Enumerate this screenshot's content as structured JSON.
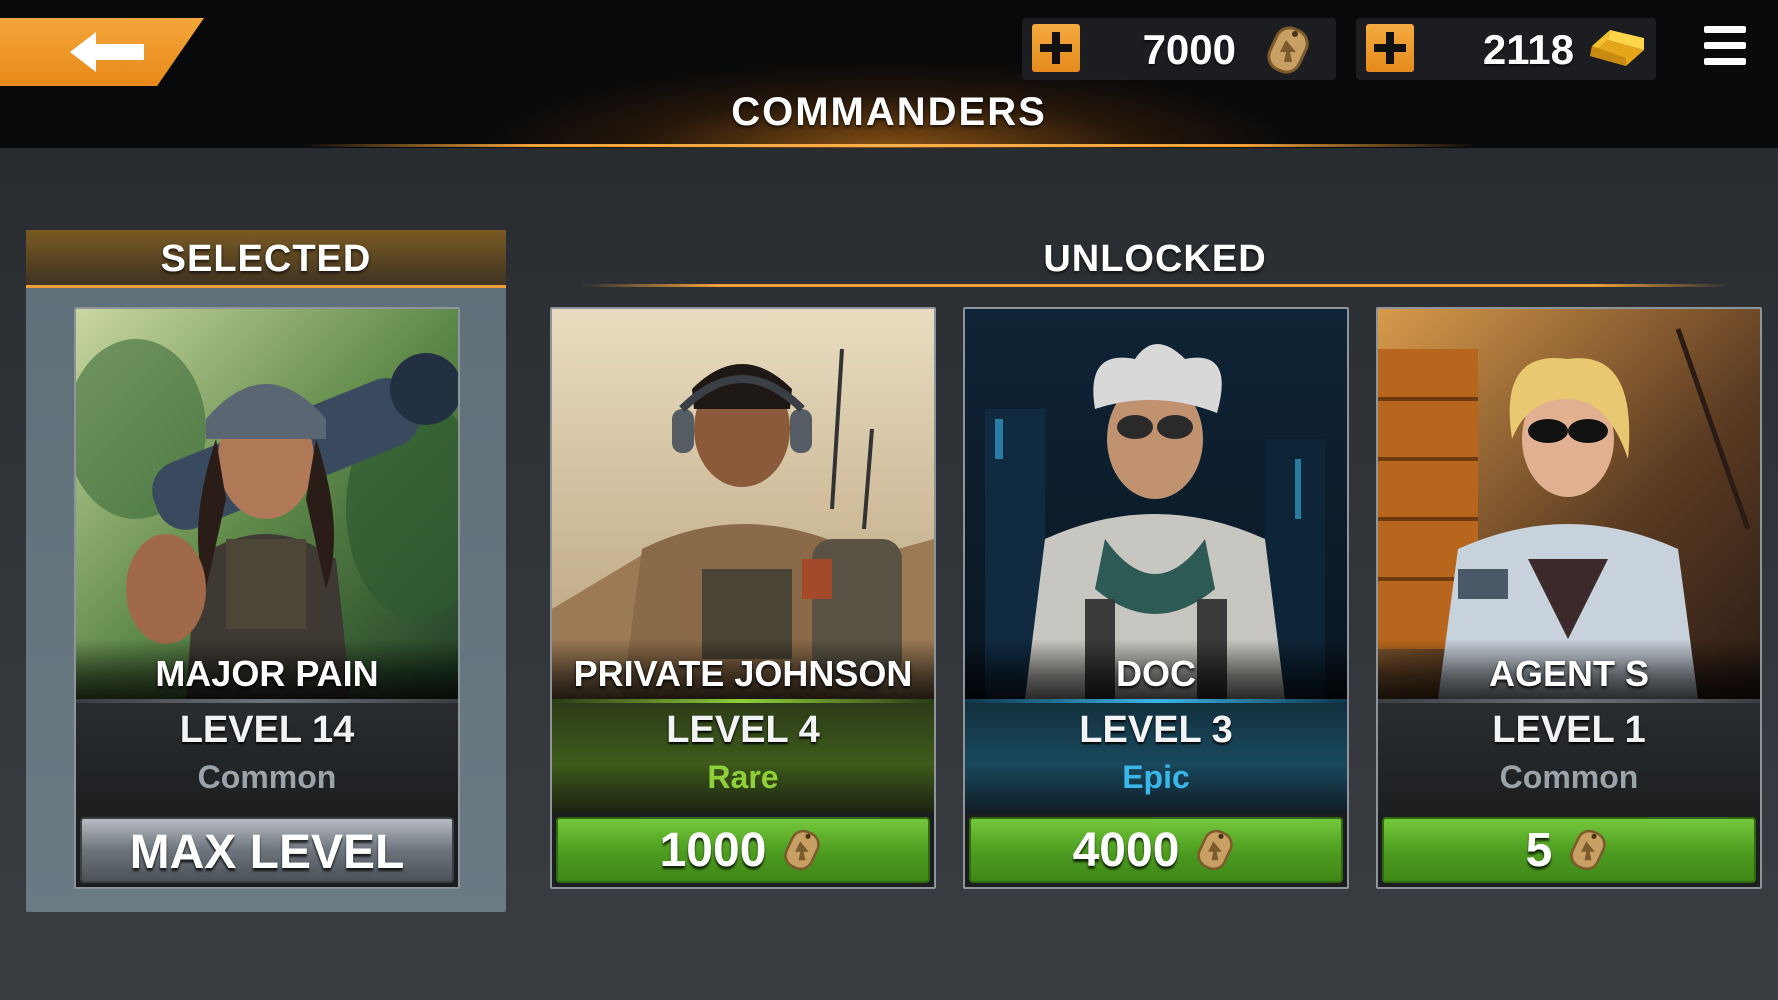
{
  "header": {
    "title": "COMMANDERS",
    "back_icon": "back-arrow-icon",
    "menu_icon": "hamburger-menu-icon"
  },
  "currencies": {
    "dog_tags": {
      "value": "7000",
      "icon": "dog-tag-icon"
    },
    "gold": {
      "value": "2118",
      "icon": "gold-bar-icon"
    }
  },
  "sections": {
    "selected": "SELECTED",
    "unlocked": "UNLOCKED"
  },
  "selected_commander": {
    "name": "MAJOR PAIN",
    "level": "LEVEL 14",
    "rarity": "Common",
    "button_label": "MAX LEVEL"
  },
  "unlocked_commanders": [
    {
      "name": "PRIVATE JOHNSON",
      "level": "LEVEL 4",
      "rarity": "Rare",
      "price": "1000"
    },
    {
      "name": "DOC",
      "level": "LEVEL 3",
      "rarity": "Epic",
      "price": "4000"
    },
    {
      "name": "AGENT S",
      "level": "LEVEL 1",
      "rarity": "Common",
      "price": "5"
    }
  ],
  "colors": {
    "accent_orange": "#f0a03a",
    "buy_green": "#4c9b1f",
    "rarity_common": "#9aa3a9",
    "rarity_rare": "#8fcf3a",
    "rarity_epic": "#3ab6e8"
  }
}
